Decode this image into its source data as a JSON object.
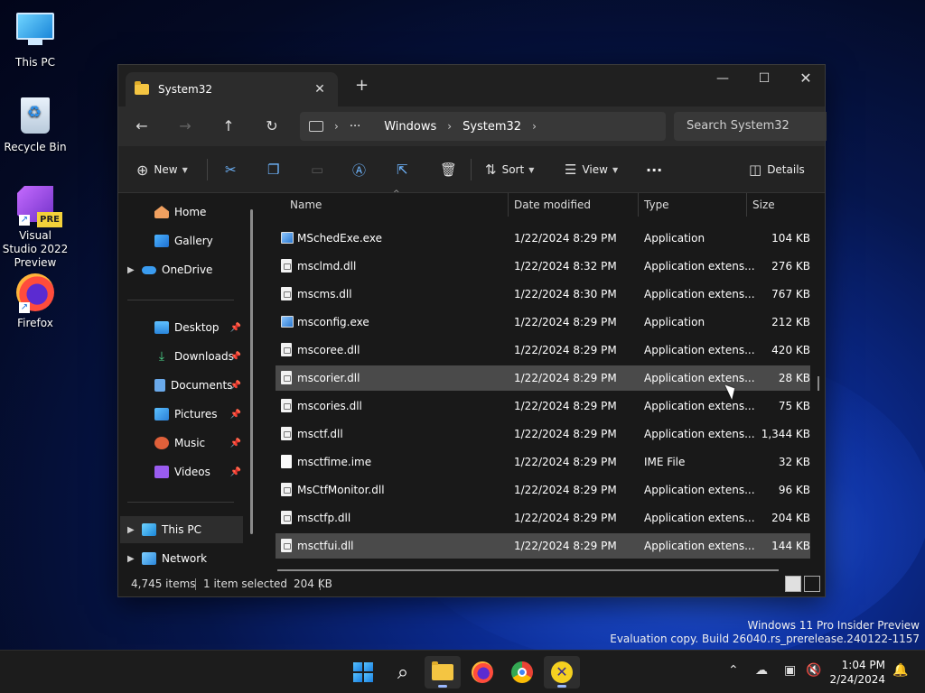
{
  "desktop": {
    "icons": [
      {
        "label": "This PC"
      },
      {
        "label": "Recycle Bin"
      },
      {
        "label": "Visual Studio 2022 Preview",
        "badge": "PRE"
      },
      {
        "label": "Firefox"
      }
    ]
  },
  "window": {
    "tab_title": "System32",
    "new_tab": "+",
    "controls": {
      "minimize": "—",
      "maximize": "☐",
      "close": "✕"
    },
    "nav": {
      "back": "←",
      "forward": "→",
      "up": "↑",
      "refresh": "↻"
    },
    "breadcrumb": {
      "more": "···",
      "items": [
        "Windows",
        "System32"
      ]
    },
    "search_placeholder": "Search System32",
    "toolbar": {
      "new_label": "New",
      "sort_label": "Sort",
      "view_label": "View",
      "more": "···",
      "details_label": "Details"
    },
    "sidebar": {
      "top": [
        {
          "label": "Home"
        },
        {
          "label": "Gallery"
        },
        {
          "label": "OneDrive"
        }
      ],
      "quick": [
        {
          "label": "Desktop"
        },
        {
          "label": "Downloads"
        },
        {
          "label": "Documents"
        },
        {
          "label": "Pictures"
        },
        {
          "label": "Music"
        },
        {
          "label": "Videos"
        }
      ],
      "bottom": [
        {
          "label": "This PC"
        },
        {
          "label": "Network"
        }
      ]
    },
    "columns": {
      "name": "Name",
      "date": "Date modified",
      "type": "Type",
      "size": "Size"
    },
    "files": [
      {
        "name": "MSchedExe.exe",
        "date": "1/22/2024 8:29 PM",
        "type": "Application",
        "size": "104 KB",
        "kind": "app"
      },
      {
        "name": "msclmd.dll",
        "date": "1/22/2024 8:32 PM",
        "type": "Application extens...",
        "size": "276 KB",
        "kind": "dll"
      },
      {
        "name": "mscms.dll",
        "date": "1/22/2024 8:30 PM",
        "type": "Application extens...",
        "size": "767 KB",
        "kind": "dll"
      },
      {
        "name": "msconfig.exe",
        "date": "1/22/2024 8:29 PM",
        "type": "Application",
        "size": "212 KB",
        "kind": "app"
      },
      {
        "name": "mscoree.dll",
        "date": "1/22/2024 8:29 PM",
        "type": "Application extens...",
        "size": "420 KB",
        "kind": "dll"
      },
      {
        "name": "mscorier.dll",
        "date": "1/22/2024 8:29 PM",
        "type": "Application extens...",
        "size": "28 KB",
        "kind": "dll"
      },
      {
        "name": "mscories.dll",
        "date": "1/22/2024 8:29 PM",
        "type": "Application extens...",
        "size": "75 KB",
        "kind": "dll"
      },
      {
        "name": "msctf.dll",
        "date": "1/22/2024 8:29 PM",
        "type": "Application extens...",
        "size": "1,344 KB",
        "kind": "dll"
      },
      {
        "name": "msctfime.ime",
        "date": "1/22/2024 8:29 PM",
        "type": "IME File",
        "size": "32 KB",
        "kind": "ime"
      },
      {
        "name": "MsCtfMonitor.dll",
        "date": "1/22/2024 8:29 PM",
        "type": "Application extens...",
        "size": "96 KB",
        "kind": "dll"
      },
      {
        "name": "msctfp.dll",
        "date": "1/22/2024 8:29 PM",
        "type": "Application extens...",
        "size": "204 KB",
        "kind": "dll"
      },
      {
        "name": "msctfui.dll",
        "date": "1/22/2024 8:29 PM",
        "type": "Application extens...",
        "size": "144 KB",
        "kind": "dll"
      }
    ],
    "status": {
      "count": "4,745 items",
      "selected": "1 item selected",
      "selected_size": "204 KB"
    }
  },
  "watermark": {
    "line1": "Windows 11 Pro Insider Preview",
    "line2": "Evaluation copy. Build 26040.rs_prerelease.240122-1157"
  },
  "taskbar": {
    "tray_chevron": "⌃",
    "time": "1:04 PM",
    "date": "2/24/2024"
  },
  "colors": {
    "accent": "#6fb6ff",
    "window_bg": "#191919",
    "selected_row": "#4a4a4a"
  }
}
